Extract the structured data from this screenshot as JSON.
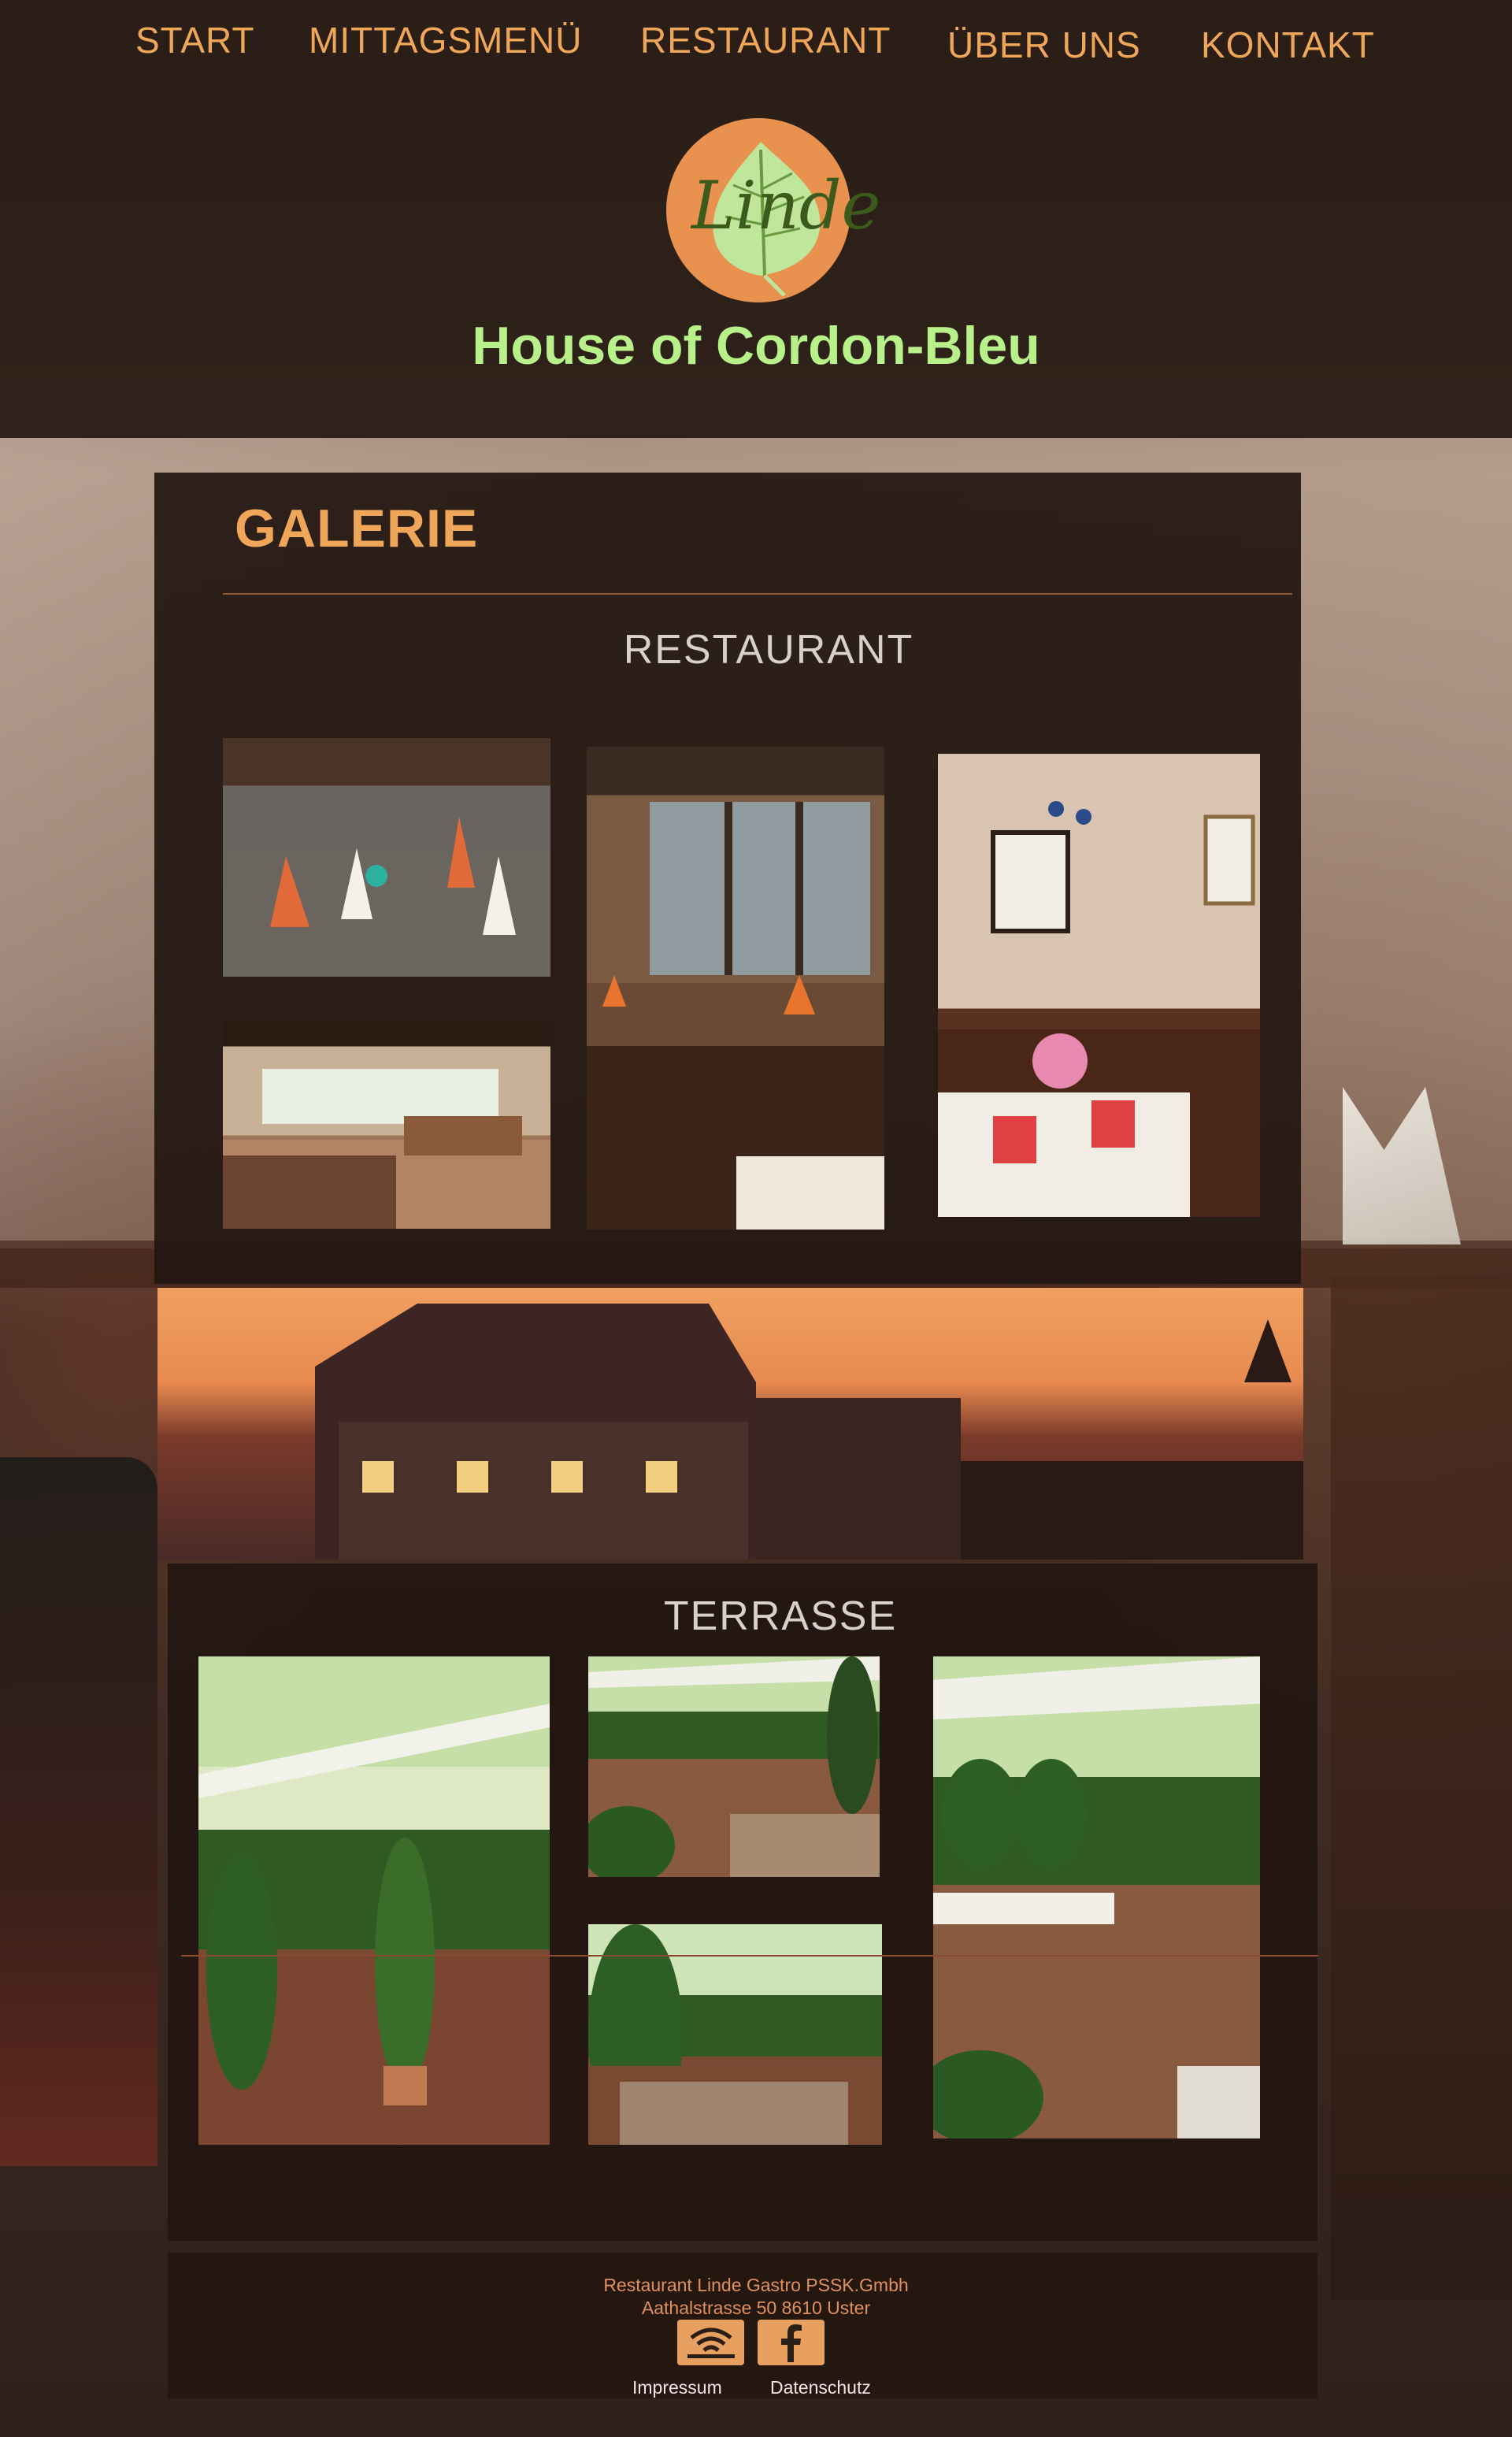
{
  "nav": {
    "items": [
      {
        "label": "START"
      },
      {
        "label": "MITTAGSMENÜ"
      },
      {
        "label": "RESTAURANT"
      },
      {
        "label": "ÜBER UNS"
      },
      {
        "label": "KONTAKT"
      }
    ]
  },
  "header": {
    "logo_text": "Linde",
    "tagline": "House of Cordon-Bleu"
  },
  "gallery": {
    "title": "GALERIE",
    "sections": [
      {
        "title": "RESTAURANT"
      },
      {
        "title": "TERRASSE"
      }
    ]
  },
  "footer": {
    "company": "Restaurant Linde Gastro PSSK.Gmbh",
    "address": "Aathalstrasse 50 8610 Uster",
    "links": [
      {
        "label": "Impressum"
      },
      {
        "label": "Datenschutz"
      }
    ],
    "social_icons": [
      "wifi-icon",
      "facebook-icon"
    ]
  },
  "colors": {
    "accent": "#f0a658",
    "tagline": "#b8f08a",
    "panel": "#221610"
  }
}
